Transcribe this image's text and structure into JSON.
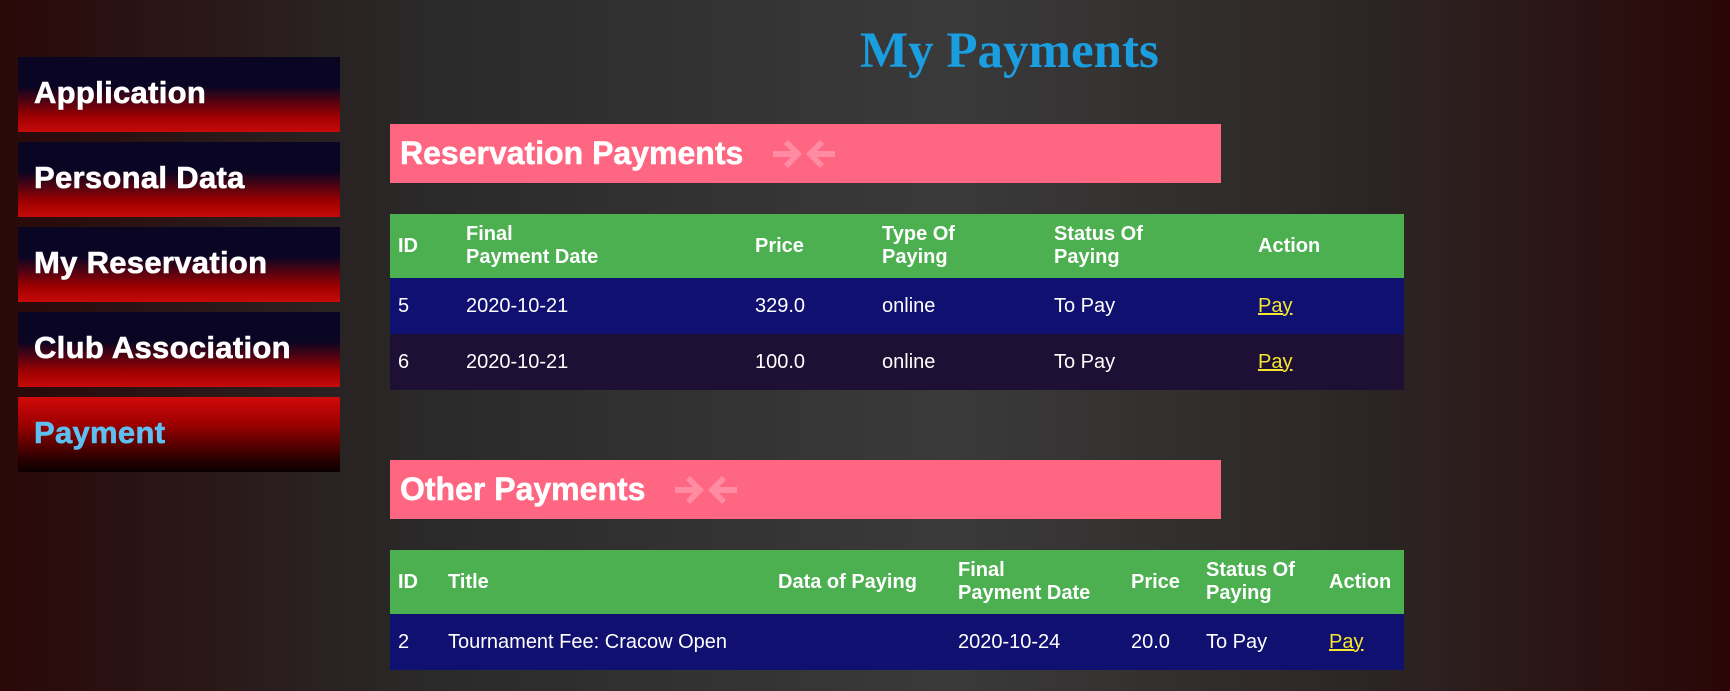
{
  "page_title": "My Payments",
  "sidebar": {
    "items": [
      {
        "label": "Application"
      },
      {
        "label": "Personal Data"
      },
      {
        "label": "My Reservation"
      },
      {
        "label": "Club Association"
      },
      {
        "label": "Payment",
        "active": true
      }
    ]
  },
  "reservation_section": {
    "title": "Reservation Payments",
    "icon": "arrows-in-icon",
    "headers": {
      "id": "ID",
      "final_date_1": "Final",
      "final_date_2": "Payment Date",
      "price": "Price",
      "type_1": "Type Of",
      "type_2": "Paying",
      "status_1": "Status Of",
      "status_2": "Paying",
      "action": "Action"
    },
    "rows": [
      {
        "id": "5",
        "final_payment_date": "2020-10-21",
        "price": "329.0",
        "type": "online",
        "status": "To Pay",
        "action": "Pay"
      },
      {
        "id": "6",
        "final_payment_date": "2020-10-21",
        "price": "100.0",
        "type": "online",
        "status": "To Pay",
        "action": "Pay"
      }
    ]
  },
  "other_section": {
    "title": "Other Payments",
    "icon": "arrows-in-icon",
    "headers": {
      "id": "ID",
      "title": "Title",
      "data_of_paying": "Data of Paying",
      "final_date_1": "Final",
      "final_date_2": "Payment Date",
      "price": "Price",
      "status_1": "Status Of",
      "status_2": "Paying",
      "action": "Action"
    },
    "rows": [
      {
        "id": "2",
        "title": "Tournament Fee: Cracow Open",
        "data_of_paying": "",
        "final_payment_date": "2020-10-24",
        "price": "20.0",
        "status": "To Pay",
        "action": "Pay"
      }
    ]
  },
  "colors": {
    "title": "#1a9ee0",
    "section_bar": "#ff6682",
    "table_header": "#4caf50",
    "row_odd": "#101070",
    "row_even": "#1e1035",
    "link": "#f5e530",
    "active_nav_text": "#5dc0f0"
  }
}
